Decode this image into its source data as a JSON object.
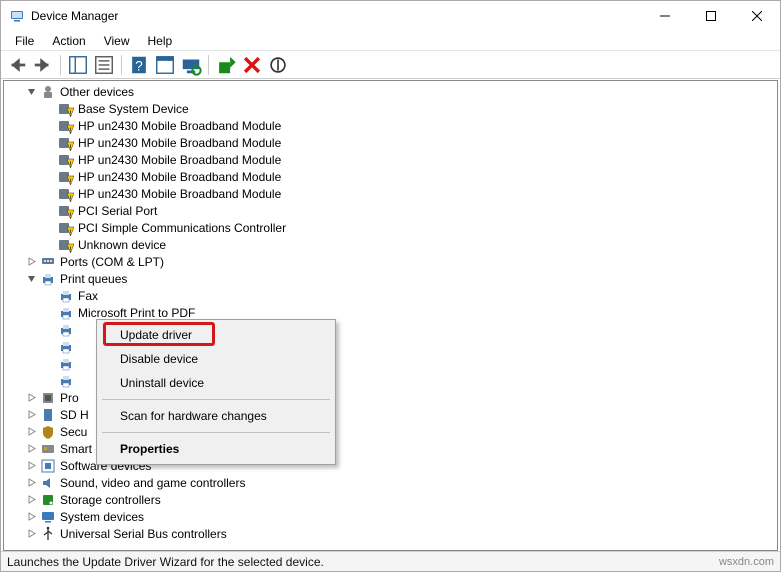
{
  "window": {
    "title": "Device Manager"
  },
  "menus": [
    "File",
    "Action",
    "View",
    "Help"
  ],
  "tree": {
    "other_devices": {
      "label": "Other devices",
      "items": [
        "Base System Device",
        "HP un2430 Mobile Broadband Module",
        "HP un2430 Mobile Broadband Module",
        "HP un2430 Mobile Broadband Module",
        "HP un2430 Mobile Broadband Module",
        "HP un2430 Mobile Broadband Module",
        "PCI Serial Port",
        "PCI Simple Communications Controller",
        "Unknown device"
      ]
    },
    "ports": {
      "label": "Ports (COM & LPT)"
    },
    "print_queues": {
      "label": "Print queues",
      "items": [
        "Fax",
        "Microsoft Print to PDF"
      ]
    },
    "processors": {
      "label": "Pro"
    },
    "sd": {
      "label": "SD H"
    },
    "security": {
      "label": "Secu"
    },
    "smart_card": {
      "label": "Smart card readers"
    },
    "software_devices": {
      "label": "Software devices"
    },
    "sound": {
      "label": "Sound, video and game controllers"
    },
    "storage": {
      "label": "Storage controllers"
    },
    "system": {
      "label": "System devices"
    },
    "usb": {
      "label": "Universal Serial Bus controllers"
    }
  },
  "context_menu": {
    "update": "Update driver",
    "disable": "Disable device",
    "uninstall": "Uninstall device",
    "scan": "Scan for hardware changes",
    "properties": "Properties"
  },
  "status": {
    "left": "Launches the Update Driver Wizard for the selected device.",
    "right": "wsxdn.com"
  }
}
